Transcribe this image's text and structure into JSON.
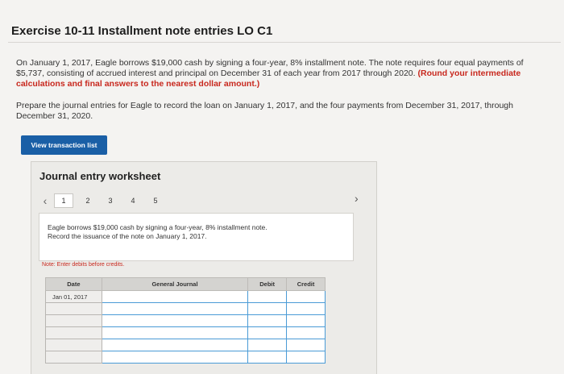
{
  "header": {
    "title": "Exercise 10-11 Installment note entries LO C1"
  },
  "problem": {
    "text_1": "On January 1, 2017, Eagle borrows $19,000 cash by signing a four-year, 8% installment note. The note requires four equal payments of $5,737, consisting of accrued interest and principal on December 31 of each year from 2017 through 2020.",
    "text_1_highlight": "(Round your intermediate calculations and final answers to the nearest dollar amount.)",
    "text_2": "Prepare the journal entries for Eagle to record the loan on January 1, 2017, and the four payments from December 31, 2017, through December 31, 2020."
  },
  "buttons": {
    "view_transactions": "View transaction list"
  },
  "worksheet": {
    "title": "Journal entry worksheet",
    "pages": [
      "1",
      "2",
      "3",
      "4",
      "5"
    ],
    "active_page": "1",
    "description_line1": "Eagle borrows $19,000 cash by signing a four-year, 8% installment note.",
    "description_line2": "Record the issuance of the note on January 1, 2017.",
    "note": "Note: Enter debits before credits.",
    "columns": [
      "Date",
      "General Journal",
      "Debit",
      "Credit"
    ],
    "rows": [
      {
        "date": "Jan 01, 2017"
      },
      {
        "date": ""
      },
      {
        "date": ""
      },
      {
        "date": ""
      },
      {
        "date": ""
      },
      {
        "date": ""
      }
    ]
  },
  "colors": {
    "accent_blue": "#1a5fa6",
    "highlight_red": "#c8281e",
    "cell_border": "#4a9bd6"
  }
}
